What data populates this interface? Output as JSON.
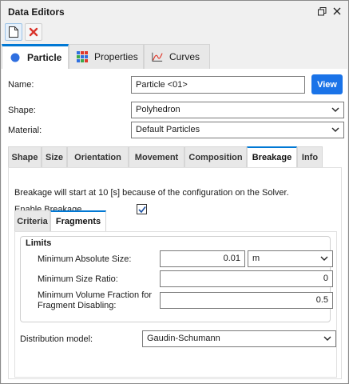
{
  "window": {
    "title": "Data Editors"
  },
  "main_tabs": [
    {
      "label": "Particle",
      "icon": "particle-dot-icon",
      "color": "#2f6fe0"
    },
    {
      "label": "Properties",
      "icon": "grid-properties-icon"
    },
    {
      "label": "Curves",
      "icon": "curve-chart-icon"
    }
  ],
  "form": {
    "name_label": "Name:",
    "name_value": "Particle <01>",
    "view_label": "View",
    "shape_label": "Shape:",
    "shape_value": "Polyhedron",
    "material_label": "Material:",
    "material_value": "Default Particles"
  },
  "sub_tabs": [
    "Shape",
    "Size",
    "Orientation",
    "Movement",
    "Composition",
    "Breakage",
    "Info"
  ],
  "breakage": {
    "info": "Breakage will start at 10 [s] because of the configuration on the Solver.",
    "enable_label": "Enable Breakage",
    "enable_checked": true
  },
  "inner_tabs": [
    "Criteria",
    "Fragments"
  ],
  "limits": {
    "title": "Limits",
    "min_abs_size_label": "Minimum Absolute Size:",
    "min_abs_size_value": "0.01",
    "min_abs_size_unit": "m",
    "min_size_ratio_label": "Minimum Size Ratio:",
    "min_size_ratio_value": "0",
    "min_vol_frac_label_1": "Minimum Volume Fraction for",
    "min_vol_frac_label_2": "Fragment Disabling:",
    "min_vol_frac_value": "0.5"
  },
  "distribution": {
    "label": "Distribution model:",
    "value": "Gaudin-Schumann"
  },
  "colors": {
    "accent": "#0078d4",
    "button": "#1a73e8",
    "close": "#d9342b"
  }
}
